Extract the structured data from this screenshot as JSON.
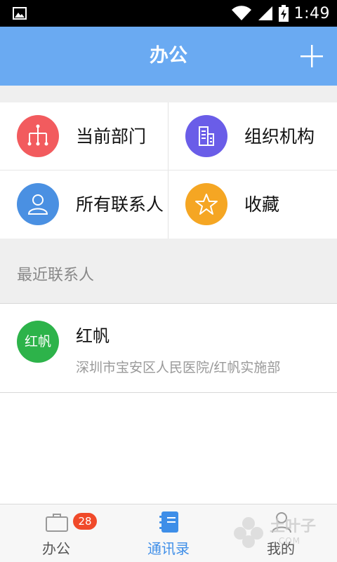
{
  "status_bar": {
    "time": "1:49"
  },
  "header": {
    "title": "办公"
  },
  "quick_grid": [
    {
      "label": "当前部门",
      "color": "#f25b5e",
      "icon": "org-tree-icon"
    },
    {
      "label": "组织机构",
      "color": "#6a5de8",
      "icon": "building-icon"
    },
    {
      "label": "所有联系人",
      "color": "#4a90e2",
      "icon": "person-icon"
    },
    {
      "label": "收藏",
      "color": "#f5a623",
      "icon": "star-icon"
    }
  ],
  "recent": {
    "title": "最近联系人",
    "contacts": [
      {
        "avatar_text": "红帆",
        "name": "红帆",
        "org": "深圳市宝安区人民医院/红帆实施部",
        "color": "#2db34a"
      }
    ]
  },
  "bottom_nav": {
    "tabs": [
      {
        "label": "办公",
        "badge": "28",
        "active": false
      },
      {
        "label": "通讯录",
        "active": true
      },
      {
        "label": "我的",
        "active": false
      }
    ],
    "active_color": "#3e8ee8",
    "inactive_color": "#555555"
  },
  "watermark": {
    "text": "土叶子",
    "sub": ".COM"
  }
}
